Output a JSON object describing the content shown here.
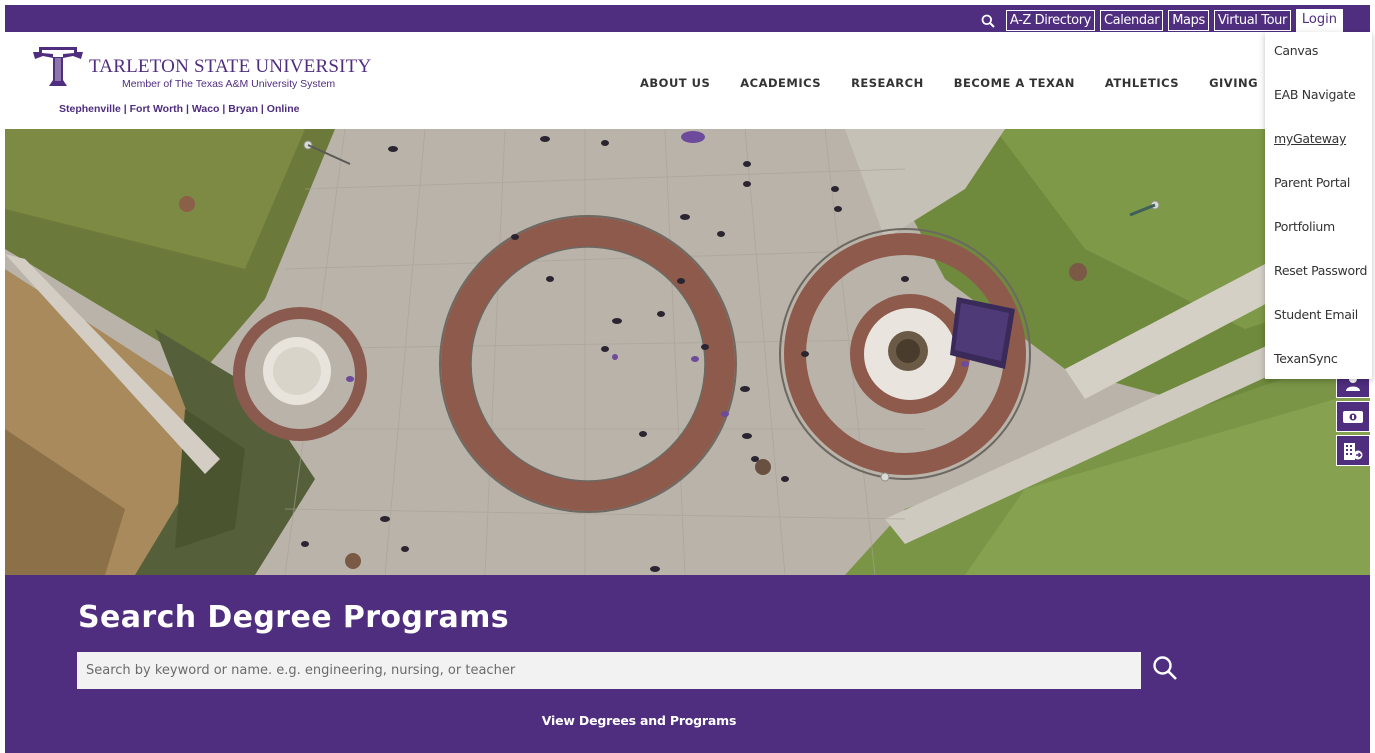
{
  "utility": {
    "links": [
      "A-Z Directory",
      "Calendar",
      "Maps",
      "Virtual Tour"
    ],
    "login_label": "Login",
    "search_icon": "search-icon"
  },
  "header": {
    "university_name": "TARLETON STATE UNIVERSITY",
    "member_text": "Member of The Texas A&M University System",
    "campuses": "Stephenville | Fort Worth | Waco | Bryan | Online",
    "nav": [
      "ABOUT US",
      "ACADEMICS",
      "RESEARCH",
      "BECOME A TEXAN",
      "ATHLETICS",
      "GIVING"
    ]
  },
  "login_menu": {
    "items": [
      "Canvas",
      "EAB Navigate",
      "myGateway",
      "Parent Portal",
      "Portfolium",
      "Reset Password",
      "Student Email",
      "TexanSync"
    ],
    "hovered": "myGateway"
  },
  "side_icons": [
    "person-icon",
    "money-icon",
    "building-icon"
  ],
  "search": {
    "title": "Search Degree Programs",
    "placeholder": "Search by keyword or name. e.g. engineering, nursing, or teacher",
    "view_link": "View Degrees and Programs"
  },
  "colors": {
    "brand_purple": "#4f2d7f",
    "white": "#ffffff",
    "nav_text": "#333333"
  }
}
